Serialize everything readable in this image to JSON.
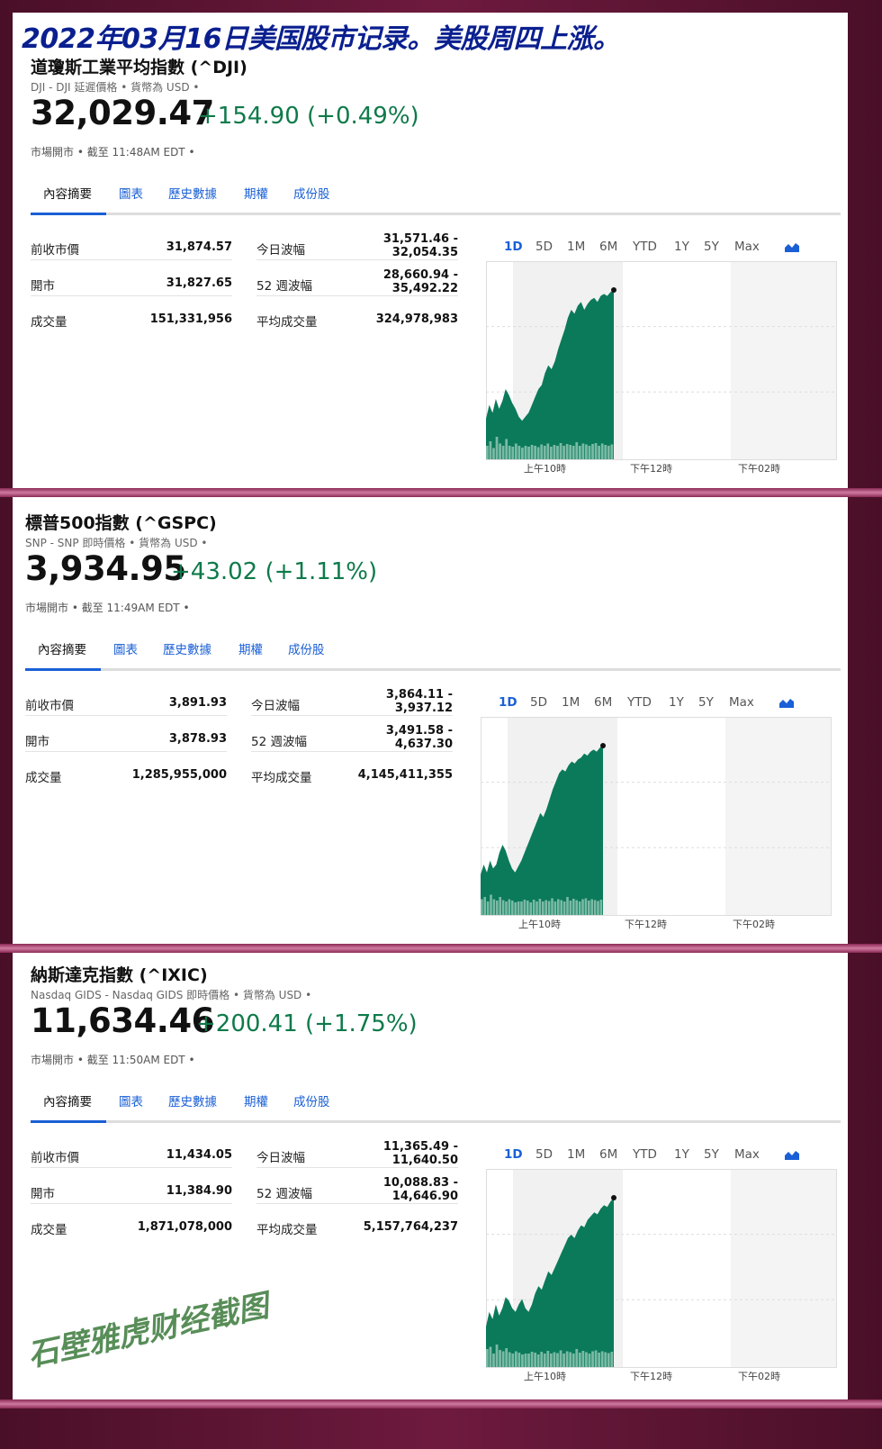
{
  "headline": "2022年03月16日美国股市记录。美股周四上涨。",
  "watermark": "石壁雅虎财经截图",
  "tabs": [
    "內容摘要",
    "圖表",
    "歷史數據",
    "期權",
    "成份股"
  ],
  "ranges": [
    "1D",
    "5D",
    "1M",
    "6M",
    "YTD",
    "1Y",
    "5Y",
    "Max"
  ],
  "time_labels": [
    "上午10時",
    "下午12時",
    "下午02時"
  ],
  "colors": {
    "up": "#0e7a4a",
    "area": "#0b7a5a",
    "link": "#1a5fd6",
    "separator": "#c0679a",
    "headline": "#0a1f8f"
  },
  "panels": [
    {
      "title": "道瓊斯工業平均指數 (^DJI)",
      "subtitle": "DJI - DJI 延遲價格 • 貨幣為 USD •",
      "price": "32,029.47",
      "change": "+154.90  (+0.49%)",
      "status": "市場開市 •  截至 11:48AM EDT •",
      "rows": [
        {
          "label": "前收市價",
          "value": "31,874.57",
          "label2": "今日波幅",
          "value2_line1": "31,571.46 -",
          "value2_line2": "32,054.35"
        },
        {
          "label": "開市",
          "value": "31,827.65",
          "label2": "52 週波幅",
          "value2_line1": "28,660.94 -",
          "value2_line2": "35,492.22"
        },
        {
          "label": "成交量",
          "value": "151,331,956",
          "label2": "平均成交量",
          "value2_line1": "324,978,983",
          "value2_line2": ""
        }
      ]
    },
    {
      "title": "標普500指數 (^GSPC)",
      "subtitle": "SNP - SNP 即時價格 • 貨幣為 USD •",
      "price": "3,934.95",
      "change": "+43.02  (+1.11%)",
      "status": "市場開市 •  截至 11:49AM EDT •",
      "rows": [
        {
          "label": "前收市價",
          "value": "3,891.93",
          "label2": "今日波幅",
          "value2_line1": "3,864.11 -",
          "value2_line2": "3,937.12"
        },
        {
          "label": "開市",
          "value": "3,878.93",
          "label2": "52 週波幅",
          "value2_line1": "3,491.58 -",
          "value2_line2": "4,637.30"
        },
        {
          "label": "成交量",
          "value": "1,285,955,000",
          "label2": "平均成交量",
          "value2_line1": "4,145,411,355",
          "value2_line2": ""
        }
      ]
    },
    {
      "title": "納斯達克指數 (^IXIC)",
      "subtitle": "Nasdaq GIDS - Nasdaq GIDS 即時價格 • 貨幣為 USD •",
      "price": "11,634.46",
      "change": "+200.41  (+1.75%)",
      "status": "市場開市 •  截至 11:50AM EDT •",
      "rows": [
        {
          "label": "前收市價",
          "value": "11,434.05",
          "label2": "今日波幅",
          "value2_line1": "11,365.49 -",
          "value2_line2": "11,640.50"
        },
        {
          "label": "開市",
          "value": "11,384.90",
          "label2": "52 週波幅",
          "value2_line1": "10,088.83 -",
          "value2_line2": "14,646.90"
        },
        {
          "label": "成交量",
          "value": "1,871,078,000",
          "label2": "平均成交量",
          "value2_line1": "5,157,764,237",
          "value2_line2": ""
        }
      ]
    }
  ],
  "chart_data": [
    {
      "type": "area",
      "series": [
        {
          "values": [
            0.35,
            0.42,
            0.38,
            0.45,
            0.4,
            0.44,
            0.5,
            0.47,
            0.43,
            0.4,
            0.36,
            0.34,
            0.36,
            0.38,
            0.42,
            0.46,
            0.5,
            0.52,
            0.58,
            0.62,
            0.6,
            0.64,
            0.7,
            0.75,
            0.8,
            0.86,
            0.9,
            0.88,
            0.92,
            0.94,
            0.9,
            0.93,
            0.95,
            0.96,
            0.94,
            0.97,
            0.98,
            0.97,
            0.99,
            1.0
          ]
        }
      ],
      "volume": [
        0.3,
        0.4,
        0.25,
        0.5,
        0.35,
        0.3,
        0.45,
        0.3,
        0.28,
        0.35,
        0.3,
        0.26,
        0.3,
        0.28,
        0.32,
        0.3,
        0.27,
        0.33,
        0.3,
        0.35,
        0.28,
        0.32,
        0.3,
        0.36,
        0.3,
        0.34,
        0.32,
        0.3,
        0.38,
        0.3,
        0.35,
        0.33,
        0.3,
        0.34,
        0.36,
        0.3,
        0.35,
        0.32,
        0.3,
        0.33
      ],
      "x_ticks": [
        "上午10時",
        "下午12時",
        "下午02時"
      ]
    },
    {
      "type": "area",
      "series": [
        {
          "values": [
            0.35,
            0.4,
            0.36,
            0.42,
            0.38,
            0.4,
            0.46,
            0.5,
            0.47,
            0.42,
            0.38,
            0.36,
            0.39,
            0.42,
            0.46,
            0.5,
            0.54,
            0.58,
            0.62,
            0.66,
            0.64,
            0.68,
            0.73,
            0.78,
            0.82,
            0.86,
            0.88,
            0.87,
            0.9,
            0.92,
            0.91,
            0.93,
            0.94,
            0.96,
            0.95,
            0.97,
            0.98,
            0.97,
            0.99,
            1.0
          ]
        }
      ],
      "volume": [
        0.35,
        0.4,
        0.3,
        0.45,
        0.35,
        0.32,
        0.4,
        0.33,
        0.3,
        0.35,
        0.32,
        0.28,
        0.3,
        0.3,
        0.34,
        0.32,
        0.28,
        0.34,
        0.3,
        0.36,
        0.3,
        0.33,
        0.31,
        0.37,
        0.3,
        0.35,
        0.33,
        0.3,
        0.4,
        0.32,
        0.36,
        0.33,
        0.3,
        0.35,
        0.37,
        0.32,
        0.35,
        0.33,
        0.31,
        0.34
      ],
      "x_ticks": [
        "上午10時",
        "下午12時",
        "下午02時"
      ]
    },
    {
      "type": "area",
      "series": [
        {
          "values": [
            0.3,
            0.38,
            0.34,
            0.42,
            0.36,
            0.4,
            0.46,
            0.44,
            0.4,
            0.38,
            0.42,
            0.45,
            0.4,
            0.38,
            0.42,
            0.48,
            0.52,
            0.5,
            0.55,
            0.6,
            0.58,
            0.62,
            0.66,
            0.7,
            0.74,
            0.78,
            0.8,
            0.78,
            0.82,
            0.85,
            0.84,
            0.88,
            0.9,
            0.92,
            0.91,
            0.94,
            0.96,
            0.95,
            0.98,
            1.0
          ]
        }
      ],
      "volume": [
        0.4,
        0.45,
        0.3,
        0.5,
        0.38,
        0.35,
        0.42,
        0.33,
        0.3,
        0.35,
        0.32,
        0.28,
        0.3,
        0.3,
        0.34,
        0.32,
        0.28,
        0.34,
        0.3,
        0.36,
        0.3,
        0.33,
        0.31,
        0.37,
        0.3,
        0.35,
        0.33,
        0.3,
        0.4,
        0.32,
        0.36,
        0.33,
        0.3,
        0.35,
        0.37,
        0.32,
        0.35,
        0.33,
        0.31,
        0.34
      ],
      "x_ticks": [
        "上午10時",
        "下午12時",
        "下午02時"
      ]
    }
  ]
}
